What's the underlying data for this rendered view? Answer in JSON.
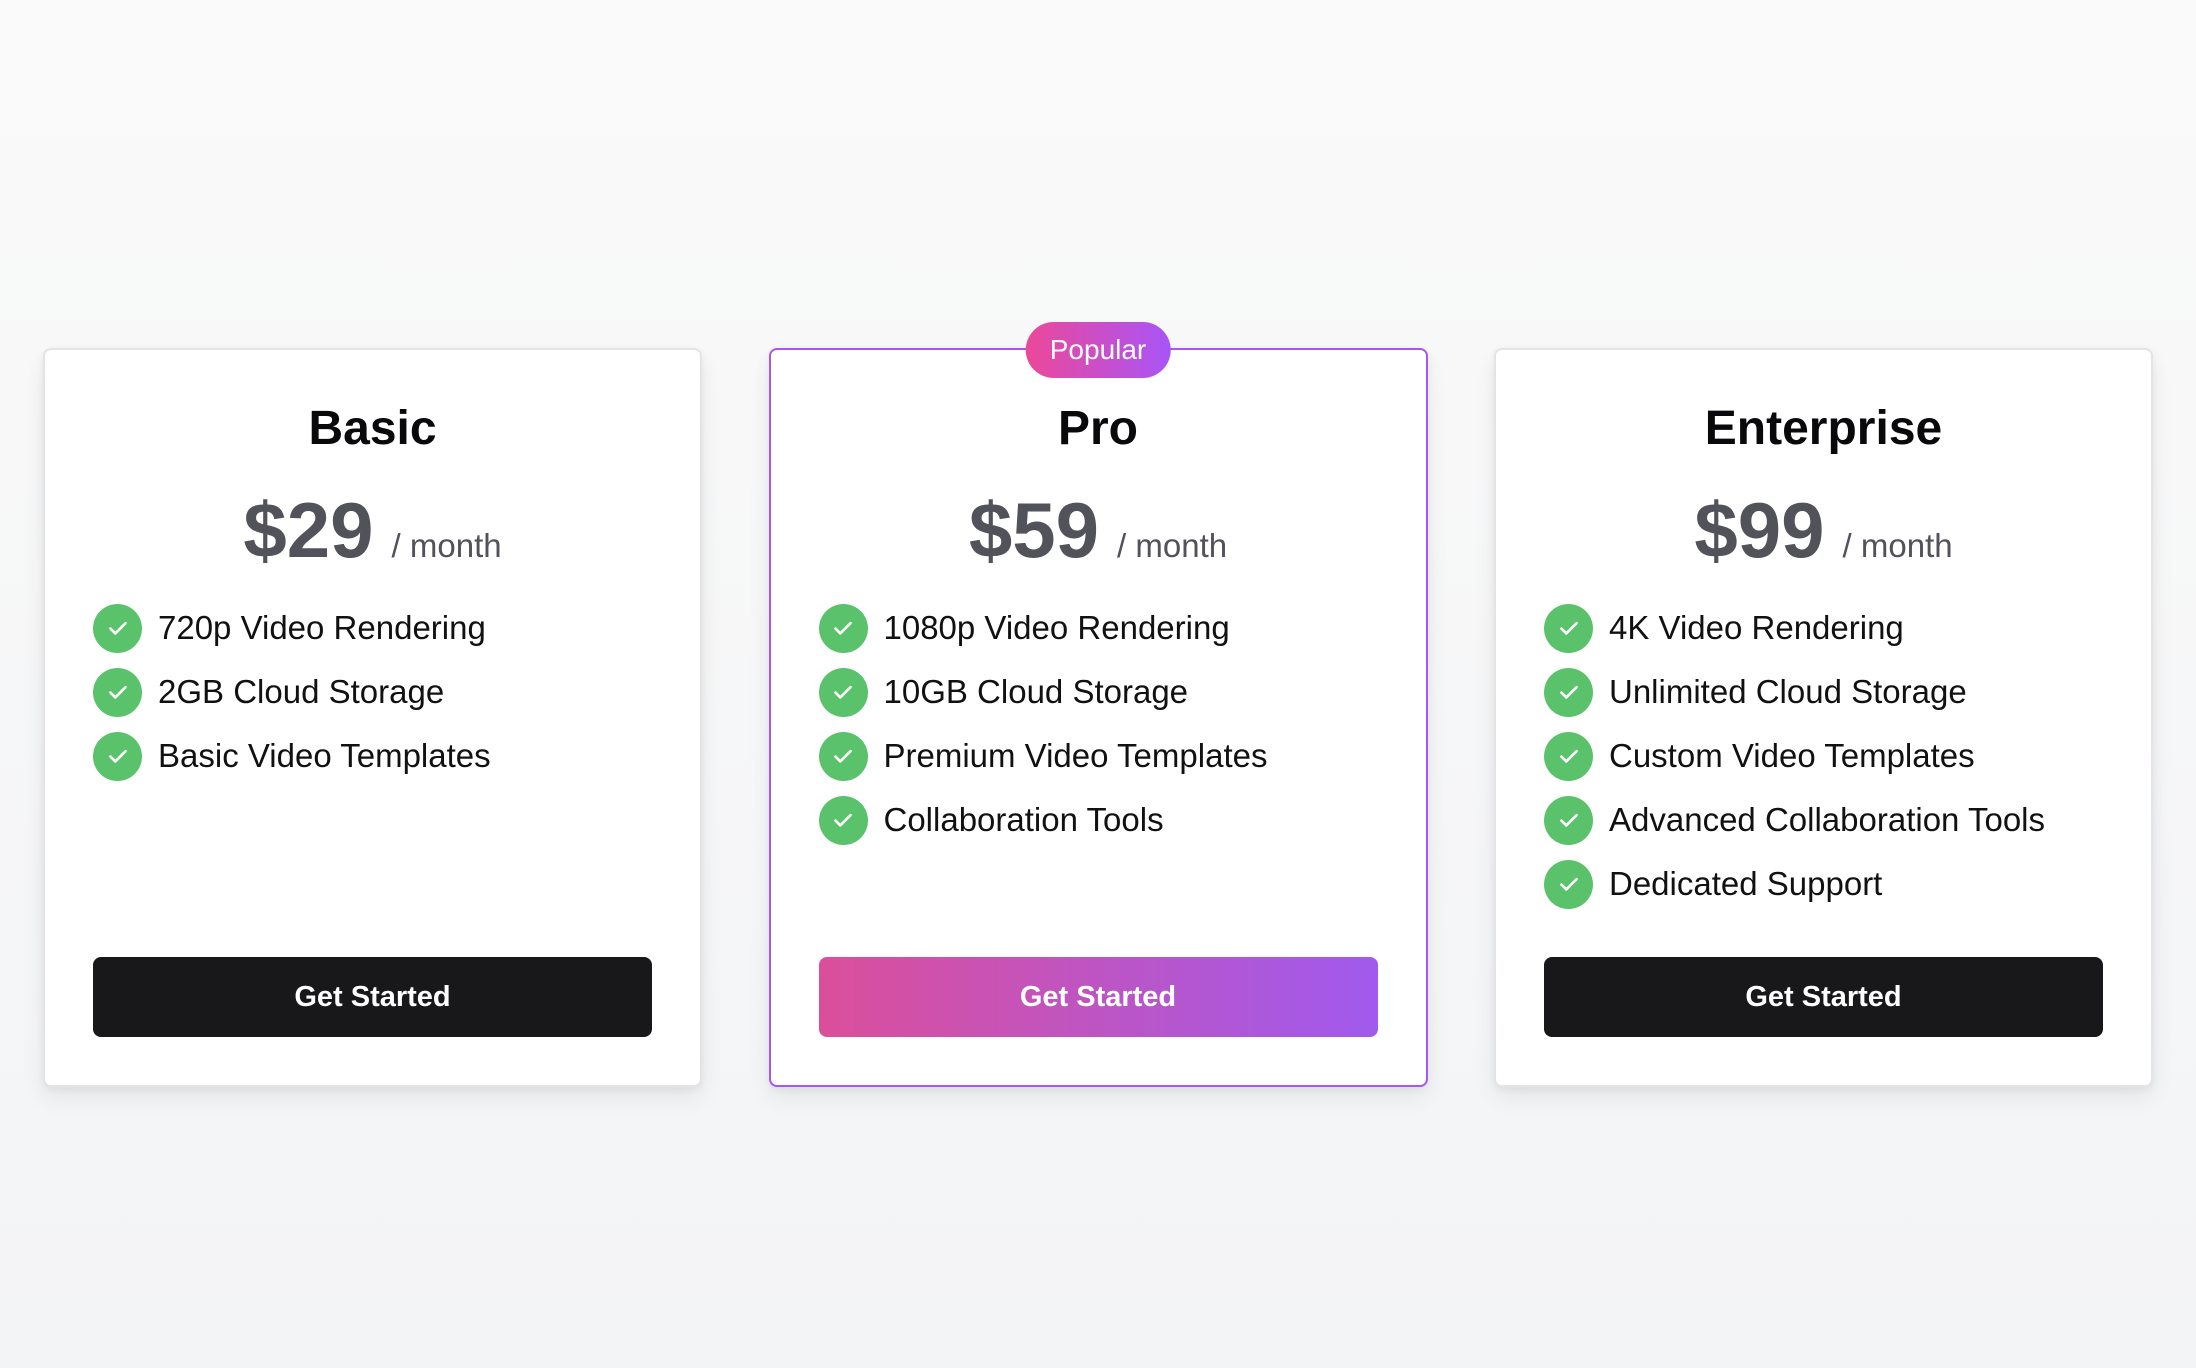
{
  "plans": [
    {
      "name": "Basic",
      "price": "$29",
      "period": "/ month",
      "features": [
        "720p Video Rendering",
        "2GB Cloud Storage",
        "Basic Video Templates"
      ],
      "cta": "Get Started"
    },
    {
      "name": "Pro",
      "badge": "Popular",
      "price": "$59",
      "period": "/ month",
      "features": [
        "1080p Video Rendering",
        "10GB Cloud Storage",
        "Premium Video Templates",
        "Collaboration Tools"
      ],
      "cta": "Get Started"
    },
    {
      "name": "Enterprise",
      "price": "$99",
      "period": "/ month",
      "features": [
        "4K Video Rendering",
        "Unlimited Cloud Storage",
        "Custom Video Templates",
        "Advanced Collaboration Tools",
        "Dedicated Support"
      ],
      "cta": "Get Started"
    }
  ],
  "icons": {
    "feature_check": "check-circle-icon"
  },
  "colors": {
    "check_green": "#5ac26a",
    "button_dark": "#18181b",
    "popular_gradient_start": "#ec4899",
    "popular_gradient_end": "#a855f7",
    "price_gray": "#52525b"
  }
}
